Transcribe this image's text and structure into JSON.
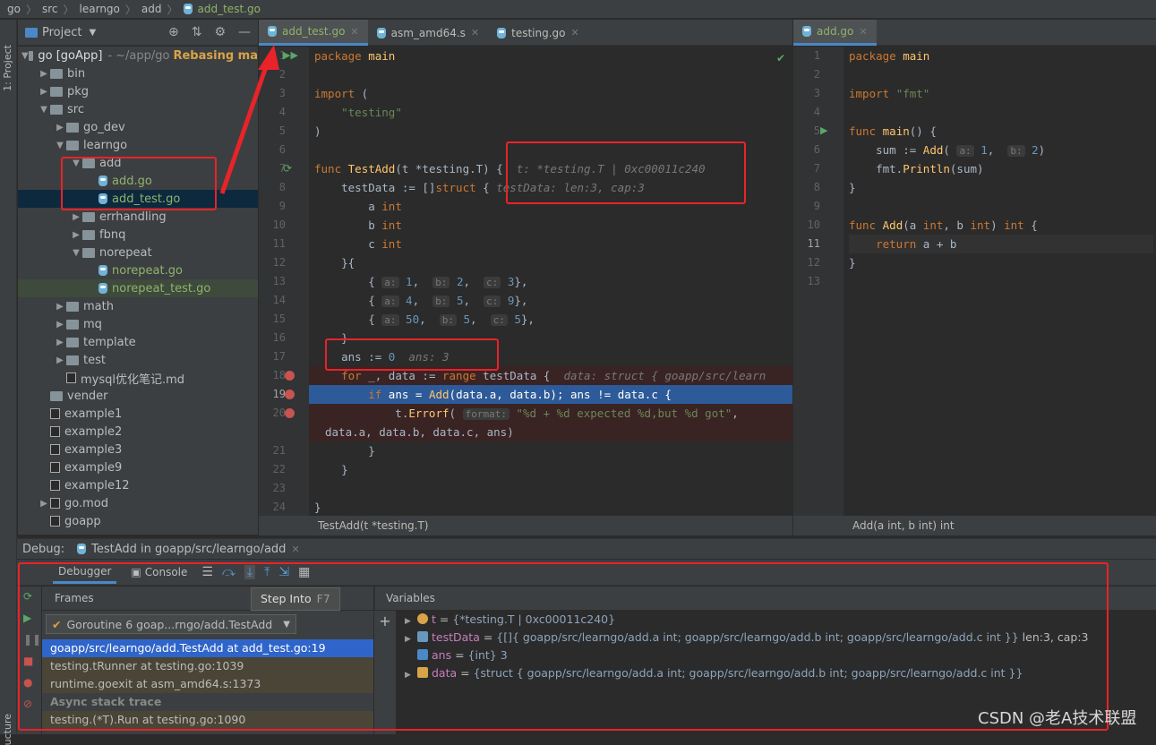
{
  "breadcrumb": [
    "go",
    "src",
    "learngo",
    "add",
    "add_test.go"
  ],
  "left_strip": {
    "project_label": "1: Project",
    "structure_label": "ucture"
  },
  "project_panel": {
    "title": "Project",
    "root": "go [goApp]",
    "root_path": "~/app/go",
    "root_status": "Rebasing ma",
    "tree": [
      {
        "label": "bin",
        "depth": 1,
        "kind": "folder",
        "expanded": false
      },
      {
        "label": "pkg",
        "depth": 1,
        "kind": "folder",
        "expanded": false
      },
      {
        "label": "src",
        "depth": 1,
        "kind": "folder",
        "expanded": true
      },
      {
        "label": "go_dev",
        "depth": 2,
        "kind": "folder",
        "expanded": false
      },
      {
        "label": "learngo",
        "depth": 2,
        "kind": "folder",
        "expanded": true
      },
      {
        "label": "add",
        "depth": 3,
        "kind": "folder",
        "expanded": true
      },
      {
        "label": "add.go",
        "depth": 4,
        "kind": "gofile"
      },
      {
        "label": "add_test.go",
        "depth": 4,
        "kind": "gofile",
        "selected": true
      },
      {
        "label": "errhandling",
        "depth": 3,
        "kind": "folder",
        "expanded": false
      },
      {
        "label": "fbnq",
        "depth": 3,
        "kind": "folder",
        "expanded": false
      },
      {
        "label": "norepeat",
        "depth": 3,
        "kind": "folder",
        "expanded": true
      },
      {
        "label": "norepeat.go",
        "depth": 4,
        "kind": "gofile"
      },
      {
        "label": "norepeat_test.go",
        "depth": 4,
        "kind": "gofile",
        "highlight": true
      },
      {
        "label": "math",
        "depth": 2,
        "kind": "folder",
        "expanded": false
      },
      {
        "label": "mq",
        "depth": 2,
        "kind": "folder",
        "expanded": false
      },
      {
        "label": "template",
        "depth": 2,
        "kind": "folder",
        "expanded": false
      },
      {
        "label": "test",
        "depth": 2,
        "kind": "folder",
        "expanded": false
      },
      {
        "label": "mysql优化笔记.md",
        "depth": 2,
        "kind": "file"
      },
      {
        "label": "vender",
        "depth": 1,
        "kind": "folder",
        "leaf": true
      },
      {
        "label": "example1",
        "depth": 1,
        "kind": "file"
      },
      {
        "label": "example2",
        "depth": 1,
        "kind": "file"
      },
      {
        "label": "example3",
        "depth": 1,
        "kind": "file"
      },
      {
        "label": "example9",
        "depth": 1,
        "kind": "file"
      },
      {
        "label": "example12",
        "depth": 1,
        "kind": "file"
      },
      {
        "label": "go.mod",
        "depth": 1,
        "kind": "file",
        "expanded": false
      },
      {
        "label": "goapp",
        "depth": 1,
        "kind": "file"
      }
    ]
  },
  "editor_tabs": [
    {
      "label": "add_test.go",
      "active": true
    },
    {
      "label": "asm_amd64.s",
      "active": false
    },
    {
      "label": "testing.go",
      "active": false
    }
  ],
  "right_tabs": [
    {
      "label": "add.go",
      "active": true
    }
  ],
  "left_code_lines": [
    "1",
    "2",
    "3",
    "4",
    "5",
    "6",
    "7",
    "8",
    "9",
    "10",
    "11",
    "12",
    "13",
    "14",
    "15",
    "16",
    "17",
    "18",
    "19",
    "20",
    "",
    "21",
    "22",
    "23",
    "24"
  ],
  "right_code_lines": [
    "1",
    "2",
    "3",
    "4",
    "5",
    "6",
    "7",
    "8",
    "9",
    "10",
    "11",
    "12",
    "13"
  ],
  "inline_hints": {
    "t": "t: *testing.T | 0xc00011c240",
    "testData": "testData: len:3, cap:3",
    "ans": "ans: 3",
    "data": "data: struct { goapp/src/learn"
  },
  "editor_status_left": "TestAdd(t *testing.T)",
  "editor_status_right": "Add(a int, b int) int",
  "debug": {
    "label": "Debug:",
    "session": "TestAdd in goapp/src/learngo/add",
    "tabs": [
      "Debugger",
      "Console"
    ],
    "frames_header": "Frames",
    "variables_header": "Variables",
    "goroutine": "Goroutine 6 goap...rngo/add.TestAdd",
    "frames": [
      {
        "text": "goapp/src/learngo/add.TestAdd at add_test.go:19",
        "selected": true
      },
      {
        "text": "testing.tRunner at testing.go:1039"
      },
      {
        "text": "runtime.goexit at asm_amd64.s:1373"
      }
    ],
    "async_label": "Async stack trace",
    "async_frames": [
      "testing.(*T).Run at testing.go:1090"
    ],
    "tooltip": {
      "text": "Step Into",
      "key": "F7"
    },
    "variables": [
      {
        "name": "t",
        "value": "{*testing.T | 0xc00011c240}",
        "icon": "pointer-icon"
      },
      {
        "name": "testData",
        "value": "{[]{ goapp/src/learngo/add.a int; goapp/src/learngo/add.b int; goapp/src/learngo/add.c int }}",
        "extra": "len:3, cap:3",
        "icon": "list-icon"
      },
      {
        "name": "ans",
        "value": "{int} 3",
        "icon": "int-icon"
      },
      {
        "name": "data",
        "value": "{struct { goapp/src/learngo/add.a int; goapp/src/learngo/add.b int; goapp/src/learngo/add.c int }}",
        "icon": "struct-icon"
      }
    ]
  },
  "watermark": "CSDN @老A技术联盟",
  "colors": {
    "annotation": "#e8232a",
    "current_line": "#2d5a98",
    "breakpoint": "#c75450"
  }
}
